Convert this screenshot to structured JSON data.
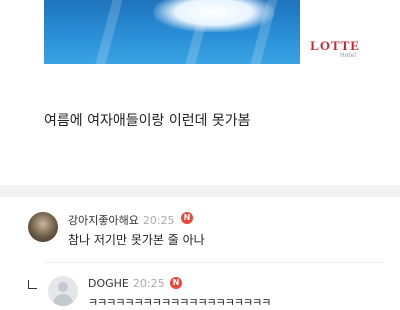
{
  "post": {
    "image_watermark": "LOTTE",
    "image_watermark_sub": "Hotel",
    "text": "여름에 여자애들이랑 이런데 못가봄"
  },
  "comments": [
    {
      "nickname": "강아지좋아해요",
      "time": "20:25",
      "badge": "N",
      "text": "참나 저기만 못가본 줄 아나"
    },
    {
      "nickname": "DOGHE",
      "time": "20:25",
      "badge": "N",
      "text": "ㅋㅋㅋㅋㅋㅋㅋㅋㅋㅋㅋㅋㅋㅋㅋㅋㅋㅋㅋㅋ"
    }
  ],
  "colors": {
    "badge": "#e8473a",
    "watermark": "#d2232a",
    "time": "#aaaaaa"
  }
}
